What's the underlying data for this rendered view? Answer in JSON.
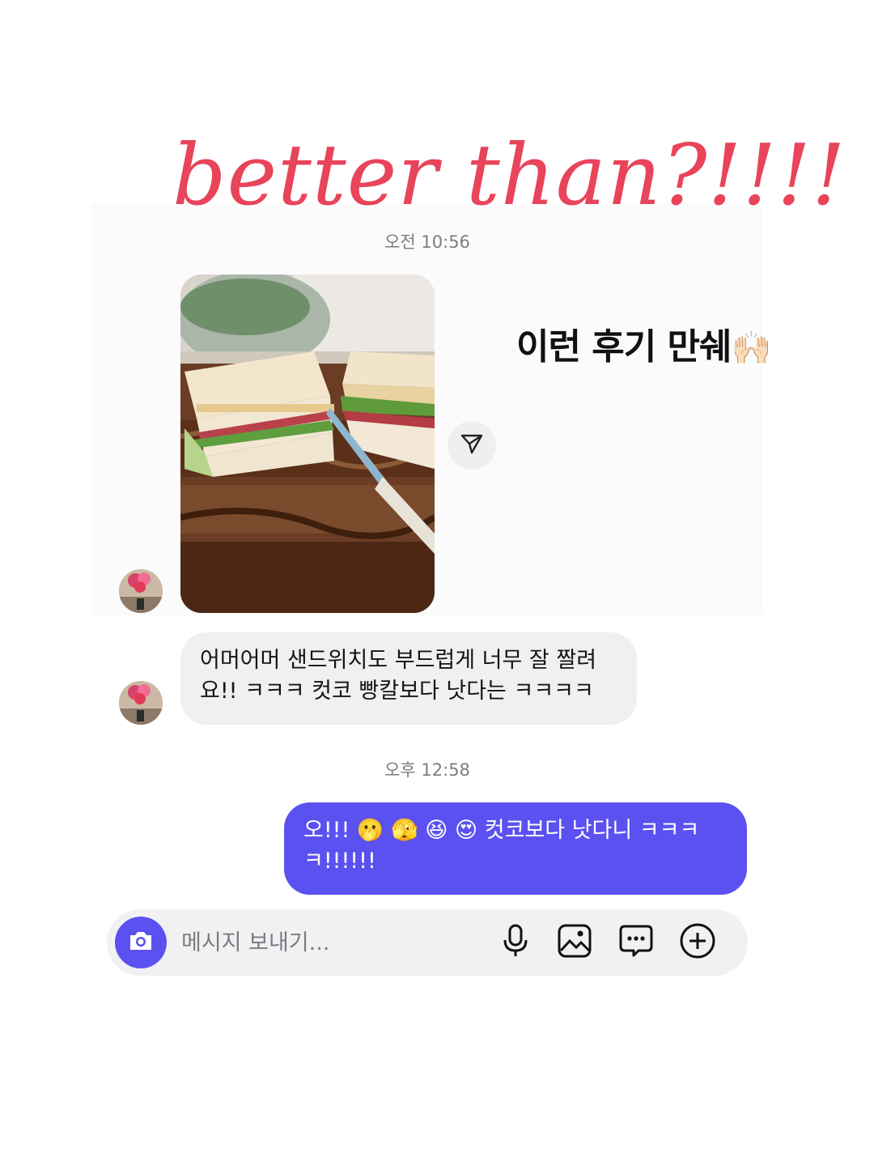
{
  "headline": {
    "text": "better than?!!!!",
    "color": "#e8445a"
  },
  "chat": {
    "timestamp_1": "오전 10:56",
    "photo_caption": "이런 후기 만쉐",
    "photo_caption_emoji": "🙌🏻",
    "incoming_message": "어머어머 샌드위치도 부드럽게 너무 잘 짤려요!! ㅋㅋㅋ 컷코 빵칼보다 낫다는 ㅋㅋㅋㅋ",
    "timestamp_2": "오후 12:58",
    "outgoing_message": "오!!! 🫢 🫣 😆 😍 컷코보다 낫다니 ㅋㅋㅋㅋ!!!!!!"
  },
  "composer": {
    "placeholder": "메시지 보내기...",
    "icons": [
      "camera-icon",
      "microphone-icon",
      "image-icon",
      "message-icon",
      "plus-icon"
    ]
  },
  "colors": {
    "accent": "#5b51f0",
    "incoming_bubble": "#f0f0f2",
    "composer_bg": "#f1f1f3"
  }
}
